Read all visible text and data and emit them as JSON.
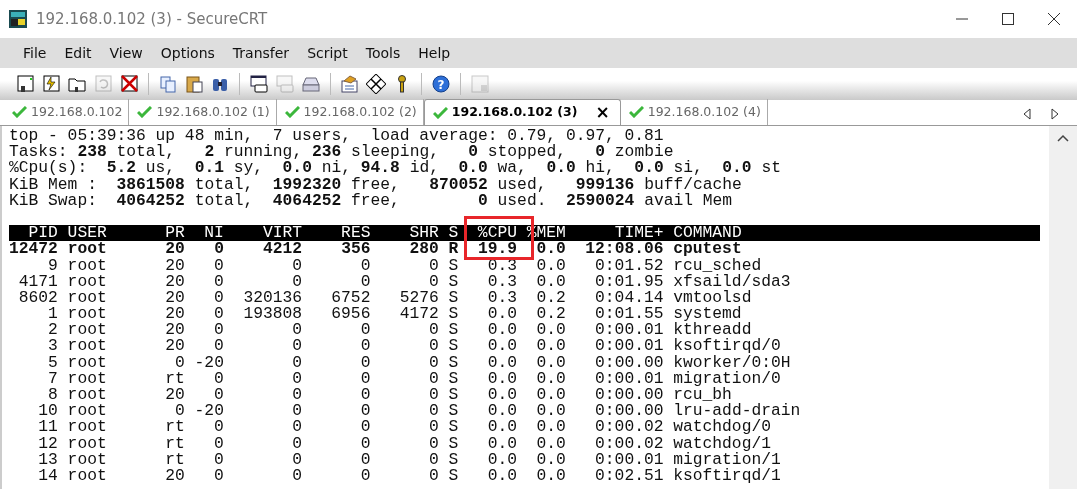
{
  "window": {
    "title": "192.168.0.102 (3) - SecureCRT"
  },
  "menu": [
    "File",
    "Edit",
    "View",
    "Options",
    "Transfer",
    "Script",
    "Tools",
    "Help"
  ],
  "toolbar_groups": [
    [
      {
        "kind": "connect",
        "disabled": false
      },
      {
        "kind": "quick-connect",
        "disabled": false
      },
      {
        "kind": "folder",
        "disabled": false
      },
      {
        "kind": "reconnect",
        "disabled": true
      },
      {
        "kind": "disconnect",
        "disabled": false
      }
    ],
    [
      {
        "kind": "copy",
        "disabled": false
      },
      {
        "kind": "paste",
        "disabled": false
      },
      {
        "kind": "find",
        "disabled": false
      }
    ],
    [
      {
        "kind": "print-screen",
        "disabled": false
      },
      {
        "kind": "print-selection",
        "disabled": true
      },
      {
        "kind": "print",
        "disabled": false
      }
    ],
    [
      {
        "kind": "options",
        "disabled": false
      },
      {
        "kind": "keymap",
        "disabled": false
      },
      {
        "kind": "key",
        "disabled": false
      }
    ],
    [
      {
        "kind": "help",
        "disabled": false,
        "glyph": "?"
      }
    ],
    [
      {
        "kind": "lock",
        "disabled": true
      }
    ]
  ],
  "tabs": [
    {
      "label": "192.168.0.102",
      "selected": false
    },
    {
      "label": "192.168.0.102 (1)",
      "selected": false
    },
    {
      "label": "192.168.0.102 (2)",
      "selected": false
    },
    {
      "label": "192.168.0.102 (3)",
      "selected": true
    },
    {
      "label": "192.168.0.102 (4)",
      "selected": false
    }
  ],
  "tab_close": "×",
  "terminal": {
    "summary": [
      "top - 05:39:36 up 48 min,  7 users,  load average: 0.79, 0.97, 0.81",
      "Tasks: **238** total,   **2** running, **236** sleeping,   **0** stopped,   **0** zombie",
      "%Cpu(s):  **5.2** us,  **0.1** sy,  **0.0** ni, **94.8** id,  **0.0** wa,  **0.0** hi,  **0.0** si,  **0.0** st",
      "KiB Mem :  **3861508** total,  **1992320** free,   **870052** used,   **999136** buff/cache",
      "KiB Swap:  **4064252** total,  **4064252** free,        **0** used.  **2590024** avail Mem"
    ],
    "columns": [
      {
        "label": "PID",
        "boxed": false
      },
      {
        "label": "USER",
        "boxed": false
      },
      {
        "label": "PR",
        "boxed": false
      },
      {
        "label": "NI",
        "boxed": false
      },
      {
        "label": "VIRT",
        "boxed": false
      },
      {
        "label": "RES",
        "boxed": false
      },
      {
        "label": "SHR",
        "boxed": false
      },
      {
        "label": "S",
        "boxed": false
      },
      {
        "label": "%CPU",
        "boxed": true
      },
      {
        "label": "%MEM",
        "boxed": false
      },
      {
        "label": "TIME+",
        "boxed": false
      },
      {
        "label": "COMMAND",
        "boxed": false
      }
    ],
    "rows": [
      {
        "highlighted": true,
        "cells": [
          "12472",
          "root",
          "20",
          "0",
          "4212",
          "356",
          "280",
          "R",
          "19.9",
          "0.0",
          "12:08.06",
          "cputest"
        ]
      },
      {
        "highlighted": false,
        "cells": [
          "9",
          "root",
          "20",
          "0",
          "0",
          "0",
          "0",
          "S",
          "0.3",
          "0.0",
          "0:01.52",
          "rcu_sched"
        ]
      },
      {
        "highlighted": false,
        "cells": [
          "4171",
          "root",
          "20",
          "0",
          "0",
          "0",
          "0",
          "S",
          "0.3",
          "0.0",
          "0:01.95",
          "xfsaild/sda3"
        ]
      },
      {
        "highlighted": false,
        "cells": [
          "8602",
          "root",
          "20",
          "0",
          "320136",
          "6752",
          "5276",
          "S",
          "0.3",
          "0.2",
          "0:04.14",
          "vmtoolsd"
        ]
      },
      {
        "highlighted": false,
        "cells": [
          "1",
          "root",
          "20",
          "0",
          "193808",
          "6956",
          "4172",
          "S",
          "0.0",
          "0.2",
          "0:01.55",
          "systemd"
        ]
      },
      {
        "highlighted": false,
        "cells": [
          "2",
          "root",
          "20",
          "0",
          "0",
          "0",
          "0",
          "S",
          "0.0",
          "0.0",
          "0:00.01",
          "kthreadd"
        ]
      },
      {
        "highlighted": false,
        "cells": [
          "3",
          "root",
          "20",
          "0",
          "0",
          "0",
          "0",
          "S",
          "0.0",
          "0.0",
          "0:00.01",
          "ksoftirqd/0"
        ]
      },
      {
        "highlighted": false,
        "cells": [
          "5",
          "root",
          "0",
          "-20",
          "0",
          "0",
          "0",
          "S",
          "0.0",
          "0.0",
          "0:00.00",
          "kworker/0:0H"
        ]
      },
      {
        "highlighted": false,
        "cells": [
          "7",
          "root",
          "rt",
          "0",
          "0",
          "0",
          "0",
          "S",
          "0.0",
          "0.0",
          "0:00.01",
          "migration/0"
        ]
      },
      {
        "highlighted": false,
        "cells": [
          "8",
          "root",
          "20",
          "0",
          "0",
          "0",
          "0",
          "S",
          "0.0",
          "0.0",
          "0:00.00",
          "rcu_bh"
        ]
      },
      {
        "highlighted": false,
        "cells": [
          "10",
          "root",
          "0",
          "-20",
          "0",
          "0",
          "0",
          "S",
          "0.0",
          "0.0",
          "0:00.00",
          "lru-add-drain"
        ]
      },
      {
        "highlighted": false,
        "cells": [
          "11",
          "root",
          "rt",
          "0",
          "0",
          "0",
          "0",
          "S",
          "0.0",
          "0.0",
          "0:00.02",
          "watchdog/0"
        ]
      },
      {
        "highlighted": false,
        "cells": [
          "12",
          "root",
          "rt",
          "0",
          "0",
          "0",
          "0",
          "S",
          "0.0",
          "0.0",
          "0:00.02",
          "watchdog/1"
        ]
      },
      {
        "highlighted": false,
        "cells": [
          "13",
          "root",
          "rt",
          "0",
          "0",
          "0",
          "0",
          "S",
          "0.0",
          "0.0",
          "0:00.01",
          "migration/1"
        ]
      },
      {
        "highlighted": false,
        "cells": [
          "14",
          "root",
          "20",
          "0",
          "0",
          "0",
          "0",
          "S",
          "0.0",
          "0.0",
          "0:02.51",
          "ksoftirqd/1"
        ]
      }
    ]
  }
}
